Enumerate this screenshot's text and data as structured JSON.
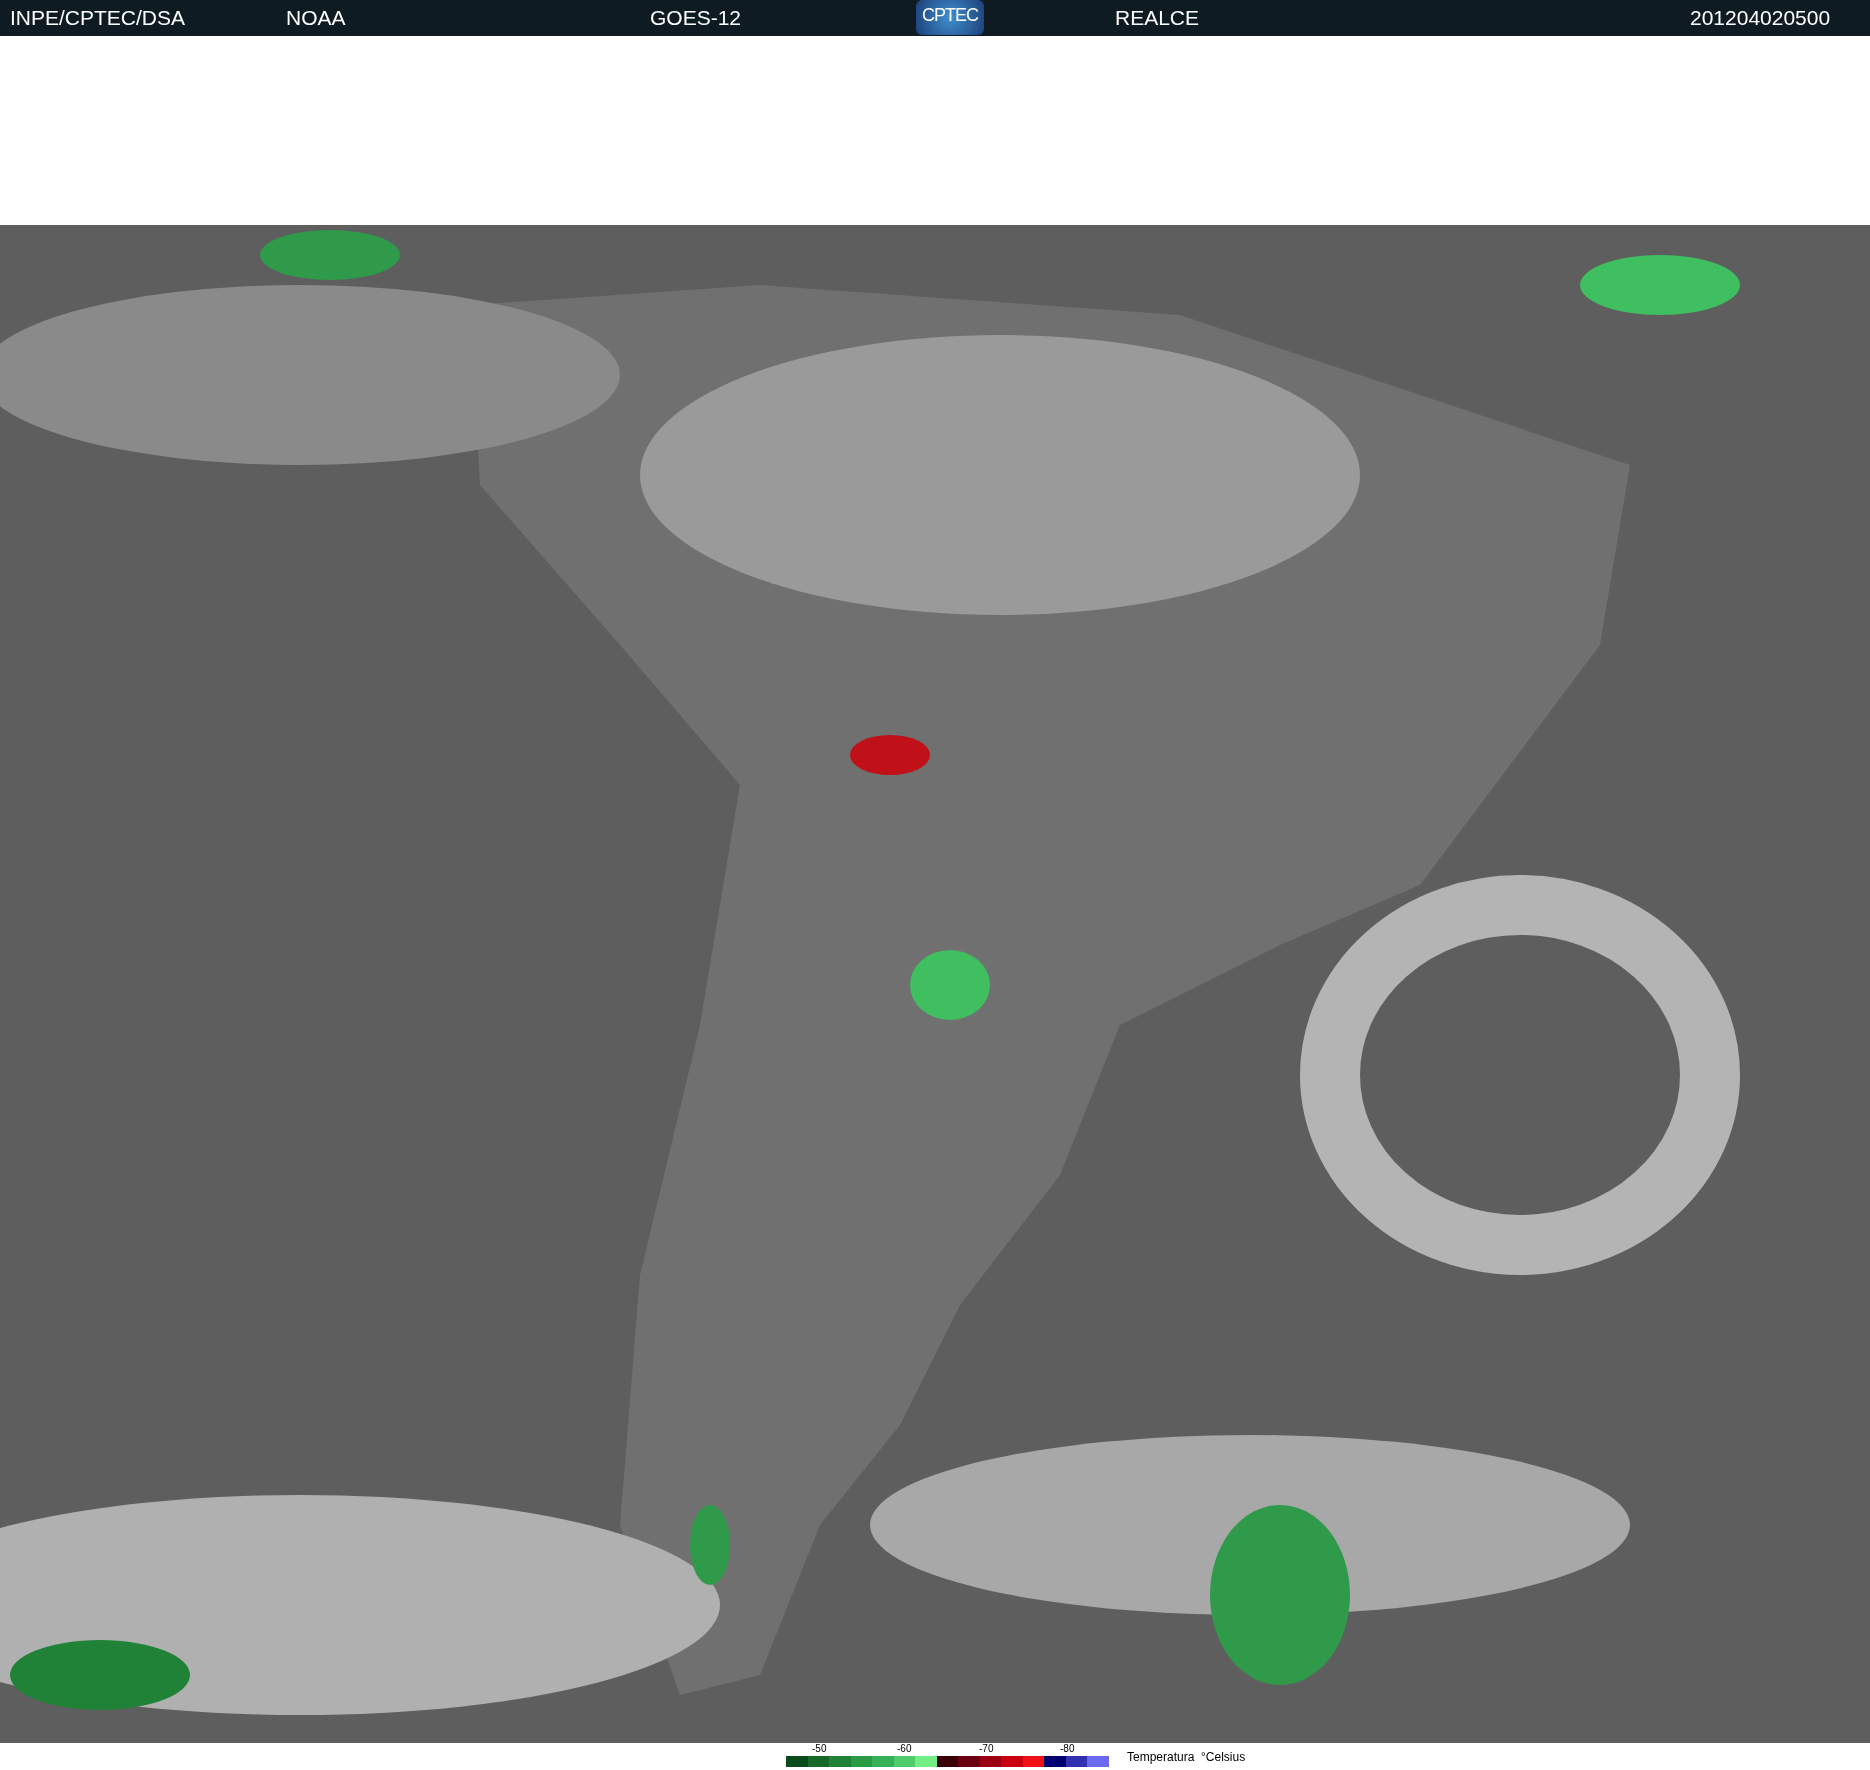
{
  "header": {
    "items": [
      "INPE/CPTEC/DSA",
      "NOAA",
      "GOES-12",
      "REALCE",
      "201204020500"
    ],
    "logo": "CPTEC"
  },
  "legend": {
    "title": "Temperatura  °Celsius",
    "ticks": [
      "-50",
      "-60",
      "-70",
      "-80"
    ],
    "swatches": [
      {
        "color": "#0b4a1a"
      },
      {
        "color": "#17692a"
      },
      {
        "color": "#1f8236"
      },
      {
        "color": "#2a9a45"
      },
      {
        "color": "#36b158"
      },
      {
        "color": "#4fcd6c"
      },
      {
        "color": "#72ee84"
      },
      {
        "color": "#3a0008"
      },
      {
        "color": "#6a0010"
      },
      {
        "color": "#9a0010"
      },
      {
        "color": "#c80010"
      },
      {
        "color": "#f01018"
      },
      {
        "color": "#000070"
      },
      {
        "color": "#3030b0"
      },
      {
        "color": "#6a6af0"
      }
    ]
  }
}
